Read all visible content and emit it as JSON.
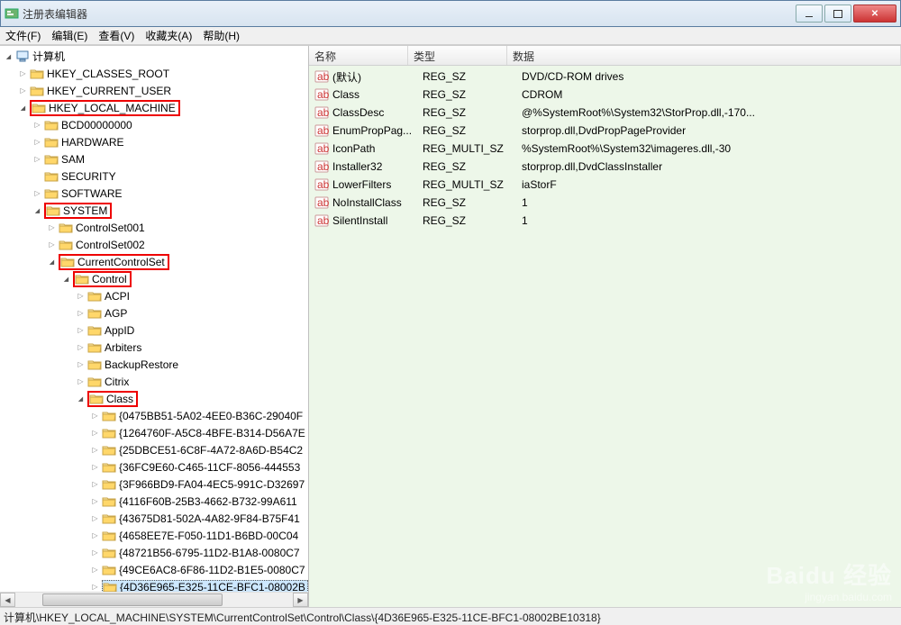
{
  "window": {
    "title": "注册表编辑器"
  },
  "menu": {
    "file": "文件(F)",
    "edit": "编辑(E)",
    "view": "查看(V)",
    "favorites": "收藏夹(A)",
    "help": "帮助(H)"
  },
  "tree": {
    "root": "计算机",
    "items": [
      {
        "label": "HKEY_CLASSES_ROOT",
        "indent": 1,
        "expand": "collapsed",
        "hl": false
      },
      {
        "label": "HKEY_CURRENT_USER",
        "indent": 1,
        "expand": "collapsed",
        "hl": false
      },
      {
        "label": "HKEY_LOCAL_MACHINE",
        "indent": 1,
        "expand": "expanded",
        "hl": true
      },
      {
        "label": "BCD00000000",
        "indent": 2,
        "expand": "collapsed",
        "hl": false
      },
      {
        "label": "HARDWARE",
        "indent": 2,
        "expand": "collapsed",
        "hl": false
      },
      {
        "label": "SAM",
        "indent": 2,
        "expand": "collapsed",
        "hl": false
      },
      {
        "label": "SECURITY",
        "indent": 2,
        "expand": "none",
        "hl": false
      },
      {
        "label": "SOFTWARE",
        "indent": 2,
        "expand": "collapsed",
        "hl": false
      },
      {
        "label": "SYSTEM",
        "indent": 2,
        "expand": "expanded",
        "hl": true
      },
      {
        "label": "ControlSet001",
        "indent": 3,
        "expand": "collapsed",
        "hl": false
      },
      {
        "label": "ControlSet002",
        "indent": 3,
        "expand": "collapsed",
        "hl": false
      },
      {
        "label": "CurrentControlSet",
        "indent": 3,
        "expand": "expanded",
        "hl": true
      },
      {
        "label": "Control",
        "indent": 4,
        "expand": "expanded",
        "hl": true
      },
      {
        "label": "ACPI",
        "indent": 5,
        "expand": "collapsed",
        "hl": false
      },
      {
        "label": "AGP",
        "indent": 5,
        "expand": "collapsed",
        "hl": false
      },
      {
        "label": "AppID",
        "indent": 5,
        "expand": "collapsed",
        "hl": false
      },
      {
        "label": "Arbiters",
        "indent": 5,
        "expand": "collapsed",
        "hl": false
      },
      {
        "label": "BackupRestore",
        "indent": 5,
        "expand": "collapsed",
        "hl": false
      },
      {
        "label": "Citrix",
        "indent": 5,
        "expand": "collapsed",
        "hl": false
      },
      {
        "label": "Class",
        "indent": 5,
        "expand": "expanded",
        "hl": true
      },
      {
        "label": "{0475BB51-5A02-4EE0-B36C-29040F",
        "indent": 6,
        "expand": "collapsed",
        "hl": false
      },
      {
        "label": "{1264760F-A5C8-4BFE-B314-D56A7E",
        "indent": 6,
        "expand": "collapsed",
        "hl": false
      },
      {
        "label": "{25DBCE51-6C8F-4A72-8A6D-B54C2",
        "indent": 6,
        "expand": "collapsed",
        "hl": false
      },
      {
        "label": "{36FC9E60-C465-11CF-8056-444553",
        "indent": 6,
        "expand": "collapsed",
        "hl": false
      },
      {
        "label": "{3F966BD9-FA04-4EC5-991C-D32697",
        "indent": 6,
        "expand": "collapsed",
        "hl": false
      },
      {
        "label": "{4116F60B-25B3-4662-B732-99A611",
        "indent": 6,
        "expand": "collapsed",
        "hl": false
      },
      {
        "label": "{43675D81-502A-4A82-9F84-B75F41",
        "indent": 6,
        "expand": "collapsed",
        "hl": false
      },
      {
        "label": "{4658EE7E-F050-11D1-B6BD-00C04",
        "indent": 6,
        "expand": "collapsed",
        "hl": false
      },
      {
        "label": "{48721B56-6795-11D2-B1A8-0080C7",
        "indent": 6,
        "expand": "collapsed",
        "hl": false
      },
      {
        "label": "{49CE6AC8-6F86-11D2-B1E5-0080C7",
        "indent": 6,
        "expand": "collapsed",
        "hl": false
      },
      {
        "label": "{4D36E965-E325-11CE-BFC1-08002B",
        "indent": 6,
        "expand": "collapsed",
        "hl": true,
        "selected": true
      }
    ]
  },
  "list": {
    "headers": {
      "name": "名称",
      "type": "类型",
      "data": "数据"
    },
    "rows": [
      {
        "name": "(默认)",
        "type": "REG_SZ",
        "data": "DVD/CD-ROM drives"
      },
      {
        "name": "Class",
        "type": "REG_SZ",
        "data": "CDROM"
      },
      {
        "name": "ClassDesc",
        "type": "REG_SZ",
        "data": "@%SystemRoot%\\System32\\StorProp.dll,-170..."
      },
      {
        "name": "EnumPropPag...",
        "type": "REG_SZ",
        "data": "storprop.dll,DvdPropPageProvider"
      },
      {
        "name": "IconPath",
        "type": "REG_MULTI_SZ",
        "data": "%SystemRoot%\\System32\\imageres.dll,-30"
      },
      {
        "name": "Installer32",
        "type": "REG_SZ",
        "data": "storprop.dll,DvdClassInstaller"
      },
      {
        "name": "LowerFilters",
        "type": "REG_MULTI_SZ",
        "data": "iaStorF"
      },
      {
        "name": "NoInstallClass",
        "type": "REG_SZ",
        "data": "1"
      },
      {
        "name": "SilentInstall",
        "type": "REG_SZ",
        "data": "1"
      }
    ]
  },
  "statusbar": "计算机\\HKEY_LOCAL_MACHINE\\SYSTEM\\CurrentControlSet\\Control\\Class\\{4D36E965-E325-11CE-BFC1-08002BE10318}",
  "watermark": {
    "brand": "Baidu 经验",
    "url": "jingyan.baidu.com"
  }
}
